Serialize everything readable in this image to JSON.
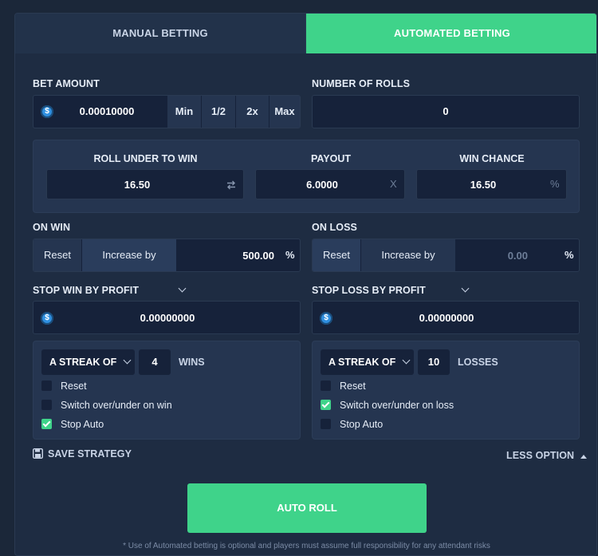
{
  "tabs": {
    "manual": "MANUAL BETTING",
    "automated": "AUTOMATED BETTING"
  },
  "bet_amount": {
    "label": "BET AMOUNT",
    "value": "0.00010000",
    "coin_icon": "usdc-coin-icon",
    "buttons": {
      "min": "Min",
      "half": "1/2",
      "double": "2x",
      "max": "Max"
    }
  },
  "rolls": {
    "label": "NUMBER OF ROLLS",
    "value": "0"
  },
  "roll": {
    "under_label": "ROLL UNDER TO WIN",
    "under_value": "16.50",
    "payout_label": "PAYOUT",
    "payout_value": "6.0000",
    "payout_suffix": "X",
    "chance_label": "WIN CHANCE",
    "chance_value": "16.50",
    "chance_suffix": "%"
  },
  "on_win": {
    "label": "ON WIN",
    "reset": "Reset",
    "increase": "Increase by",
    "value": "500.00",
    "suffix": "%"
  },
  "on_loss": {
    "label": "ON LOSS",
    "reset": "Reset",
    "increase": "Increase by",
    "value": "0.00",
    "suffix": "%"
  },
  "stop_win": {
    "label": "STOP WIN BY PROFIT",
    "value": "0.00000000"
  },
  "stop_loss": {
    "label": "STOP LOSS BY PROFIT",
    "value": "0.00000000"
  },
  "streak_win": {
    "select": "A STREAK OF",
    "count": "4",
    "word": "WINS",
    "options": [
      {
        "label": "Reset",
        "checked": false
      },
      {
        "label": "Switch over/under on win",
        "checked": false
      },
      {
        "label": "Stop Auto",
        "checked": true
      }
    ]
  },
  "streak_loss": {
    "select": "A STREAK OF",
    "count": "10",
    "word": "LOSSES",
    "options": [
      {
        "label": "Reset",
        "checked": false
      },
      {
        "label": "Switch over/under on loss",
        "checked": true
      },
      {
        "label": "Stop Auto",
        "checked": false
      }
    ]
  },
  "save_strategy": "SAVE STRATEGY",
  "less_option": "LESS OPTION",
  "auto_roll": "AUTO ROLL",
  "footnote": "* Use of Automated betting is optional and players must assume full responsibility for any attendant risks",
  "colors": {
    "accent": "#3fd38a",
    "panel": "#1e2c42",
    "input": "#16223a",
    "button": "#253550"
  }
}
